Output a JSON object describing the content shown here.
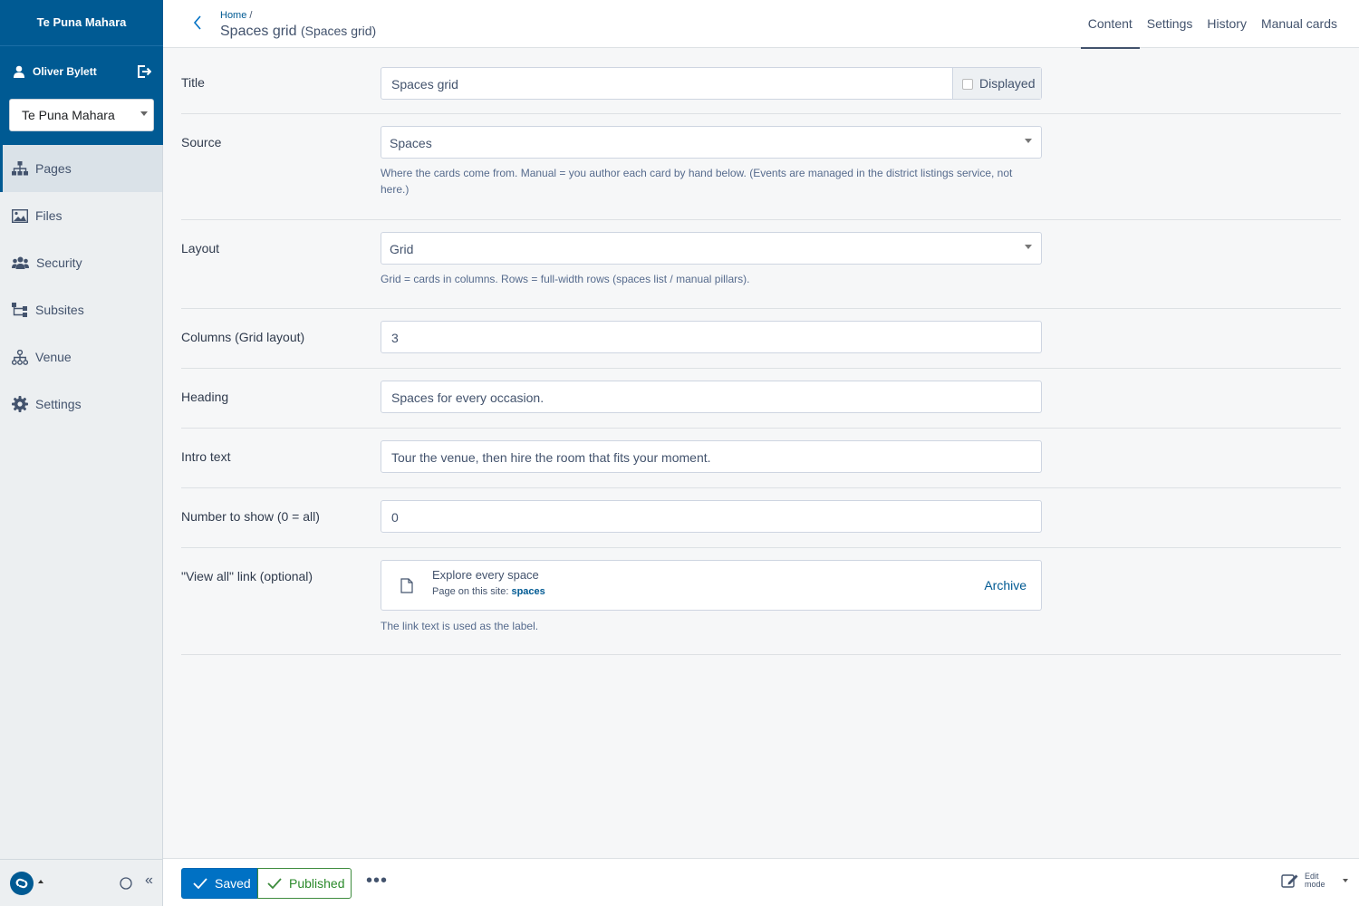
{
  "sidebar": {
    "brand": "Te Puna Mahara",
    "user": "Oliver Bylett",
    "site_select": "Te Puna Mahara",
    "items": [
      {
        "label": "Pages",
        "icon": "sitemap-icon",
        "active": true
      },
      {
        "label": "Files",
        "icon": "image-icon"
      },
      {
        "label": "Security",
        "icon": "users-icon"
      },
      {
        "label": "Subsites",
        "icon": "subsites-icon"
      },
      {
        "label": "Venue",
        "icon": "venue-icon"
      },
      {
        "label": "Settings",
        "icon": "gear-icon"
      }
    ],
    "collapse_glyph": "«"
  },
  "header": {
    "breadcrumb": "Home",
    "breadcrumb_sep": "/",
    "title": "Spaces grid",
    "title_suffix": "(Spaces grid)",
    "tabs": [
      "Content",
      "Settings",
      "History",
      "Manual cards"
    ],
    "active_tab": "Content"
  },
  "form": {
    "title": {
      "label": "Title",
      "value": "Spaces grid",
      "addon": "Displayed"
    },
    "source": {
      "label": "Source",
      "value": "Spaces",
      "help": "Where the cards come from. Manual = you author each card by hand below. (Events are managed in the district listings service, not here.)"
    },
    "layout": {
      "label": "Layout",
      "value": "Grid",
      "help": "Grid = cards in columns. Rows = full-width rows (spaces list / manual pillars)."
    },
    "columns": {
      "label": "Columns (Grid layout)",
      "value": "3"
    },
    "heading": {
      "label": "Heading",
      "value": "Spaces for every occasion."
    },
    "intro": {
      "label": "Intro text",
      "value": "Tour the venue, then hire the room that fits your moment."
    },
    "number": {
      "label": "Number to show (0 = all)",
      "value": "0"
    },
    "view_all": {
      "label": "\"View all\" link (optional)",
      "link_title": "Explore every space",
      "link_meta": "Page on this site:",
      "link_target": "spaces",
      "action": "Archive",
      "help": "The link text is used as the label."
    }
  },
  "actions": {
    "saved": "Saved",
    "published": "Published",
    "more": "•••",
    "edit_mode_1": "Edit",
    "edit_mode_2": "mode"
  },
  "colors": {
    "brand": "#005a93",
    "primary": "#0071c4",
    "success": "#3e8c3e"
  }
}
